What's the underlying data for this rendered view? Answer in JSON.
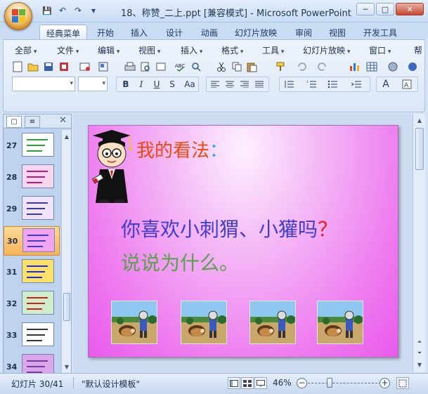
{
  "window": {
    "title": "18、称赞_二上.ppt [兼容模式] - Microsoft PowerPoint",
    "controls": {
      "minimize": "─",
      "maximize": "□",
      "close": "✕"
    }
  },
  "quick_access": {
    "save": "💾",
    "undo": "↶",
    "redo": "↷",
    "customize": "▾"
  },
  "ribbon_tabs": [
    "经典菜单",
    "开始",
    "插入",
    "设计",
    "动画",
    "幻灯片放映",
    "审阅",
    "视图",
    "开发工具"
  ],
  "active_tab": "经典菜单",
  "classic_menu": [
    "全部",
    "文件",
    "编辑",
    "视图",
    "插入",
    "格式",
    "工具",
    "幻灯片放映",
    "窗口",
    "帮"
  ],
  "toolbar_icons": [
    "new-doc",
    "open-folder",
    "save",
    "print",
    "undo",
    "redo",
    "cut",
    "copy",
    "paste",
    "format-painter",
    "chart",
    "table",
    "zoom"
  ],
  "format_buttons": {
    "bold": "B",
    "italic": "I",
    "underline": "U",
    "strike": "S",
    "font_size": "Aa"
  },
  "panel": {
    "tab_slides": "▢",
    "tab_outline": "≡",
    "close": "✕",
    "thumbnails": [
      {
        "num": "27",
        "bg": "#ffffff",
        "accent": "#2aa33a"
      },
      {
        "num": "28",
        "bg": "#f7d7ee",
        "accent": "#c0177e"
      },
      {
        "num": "29",
        "bg": "#f0e3fb",
        "accent": "#3a3aa8"
      },
      {
        "num": "30",
        "bg": "#f2a4ee",
        "accent": "#3f3ccf",
        "selected": true
      },
      {
        "num": "31",
        "bg": "#fbe06a",
        "accent": "#2a2ad0"
      },
      {
        "num": "32",
        "bg": "#cfeecb",
        "accent": "#d81b1b"
      },
      {
        "num": "33",
        "bg": "#ffffff",
        "accent": "#333333"
      },
      {
        "num": "34",
        "bg": "#dba7ea",
        "accent": "#7a3aa8"
      }
    ]
  },
  "slide": {
    "title": "我的看法",
    "title_colon": "：",
    "question_main": "你喜欢小刺猬、小獾吗",
    "question_mark": "？",
    "question_sub": "说说为什么。",
    "pictures": [
      "hedgehog-scene-1",
      "hedgehog-scene-2",
      "hedgehog-scene-3",
      "hedgehog-scene-4"
    ]
  },
  "status": {
    "slide_counter": "幻灯片 30/41",
    "theme": "\"默认设计模板\"",
    "zoom_level": "46%",
    "zoom_out": "−",
    "zoom_in": "+",
    "zoom_fraction": 0.3
  }
}
